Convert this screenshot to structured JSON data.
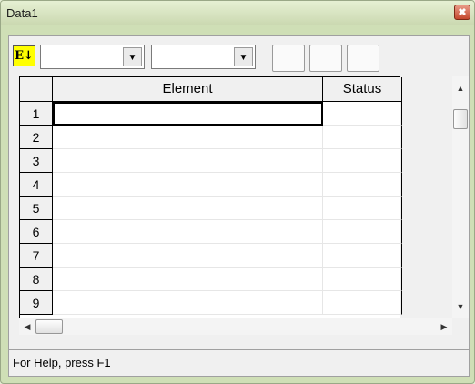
{
  "window": {
    "title": "Data1",
    "close_glyph": "✖"
  },
  "toolbar": {
    "sort_button_label": "E↓",
    "combo1": {
      "value": "",
      "arrow": "▼"
    },
    "combo2": {
      "value": "",
      "arrow": "▼"
    }
  },
  "grid": {
    "columns": [
      "Element",
      "Status"
    ],
    "rows": [
      {
        "num": "1",
        "element": "",
        "status": ""
      },
      {
        "num": "2",
        "element": "",
        "status": ""
      },
      {
        "num": "3",
        "element": "",
        "status": ""
      },
      {
        "num": "4",
        "element": "",
        "status": ""
      },
      {
        "num": "5",
        "element": "",
        "status": ""
      },
      {
        "num": "6",
        "element": "",
        "status": ""
      },
      {
        "num": "7",
        "element": "",
        "status": ""
      },
      {
        "num": "8",
        "element": "",
        "status": ""
      },
      {
        "num": "9",
        "element": "",
        "status": ""
      }
    ],
    "selected_row": "1"
  },
  "scroll": {
    "up": "▲",
    "down": "▼",
    "left": "◀",
    "right": "▶"
  },
  "statusbar": {
    "text": "For Help, press F1"
  }
}
